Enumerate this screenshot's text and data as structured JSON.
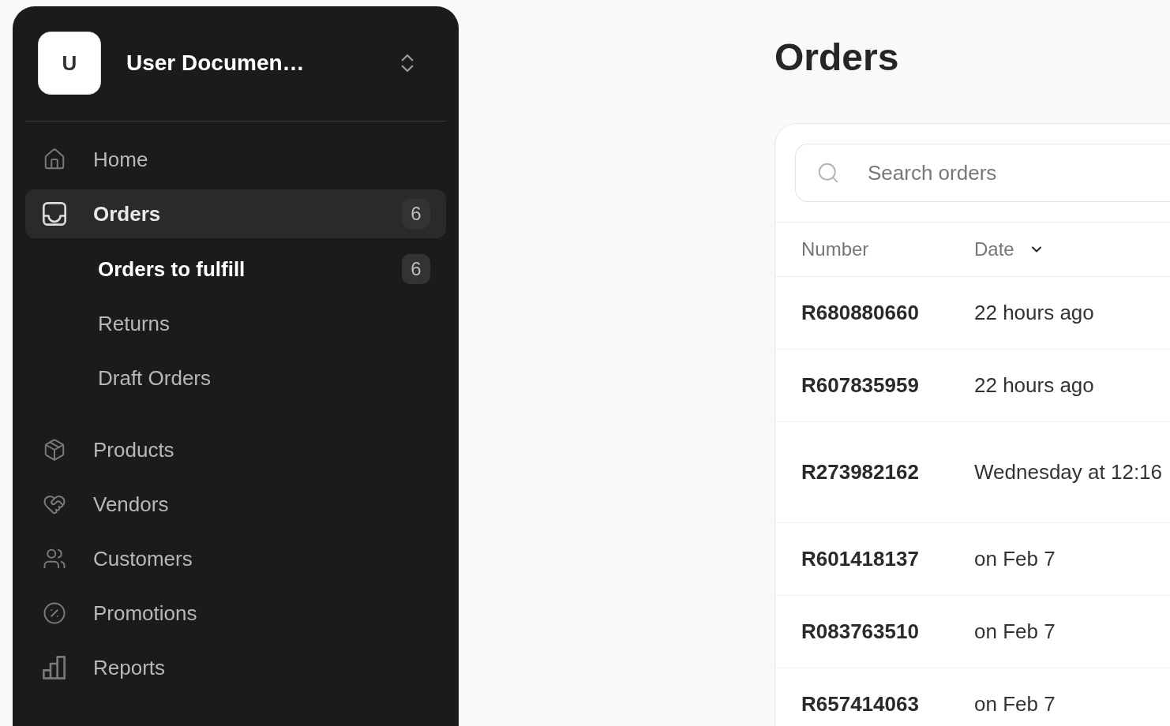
{
  "workspace": {
    "avatar_letter": "U",
    "name": "User Documen…"
  },
  "sidebar": {
    "items": [
      {
        "label": "Home",
        "selected": false
      },
      {
        "label": "Orders",
        "selected": true,
        "count": "6",
        "children": [
          {
            "label": "Orders to fulfill",
            "selected": true,
            "count": "6"
          },
          {
            "label": "Returns",
            "selected": false
          },
          {
            "label": "Draft Orders",
            "selected": false
          }
        ]
      },
      {
        "label": "Products",
        "selected": false
      },
      {
        "label": "Vendors",
        "selected": false
      },
      {
        "label": "Customers",
        "selected": false
      },
      {
        "label": "Promotions",
        "selected": false
      },
      {
        "label": "Reports",
        "selected": false
      }
    ]
  },
  "page_title": "Orders",
  "search": {
    "placeholder": "Search orders"
  },
  "table": {
    "columns": [
      {
        "label": "Number",
        "sorted": false
      },
      {
        "label": "Date",
        "sorted": true
      }
    ],
    "rows": [
      {
        "number": "R680880660",
        "date": "22 hours ago"
      },
      {
        "number": "R607835959",
        "date": "22 hours ago"
      },
      {
        "number": "R273982162",
        "date": "Wednesday at 12:16"
      },
      {
        "number": "R601418137",
        "date": "on Feb 7"
      },
      {
        "number": "R083763510",
        "date": "on Feb 7"
      },
      {
        "number": "R657414063",
        "date": "on Feb 7"
      }
    ]
  }
}
